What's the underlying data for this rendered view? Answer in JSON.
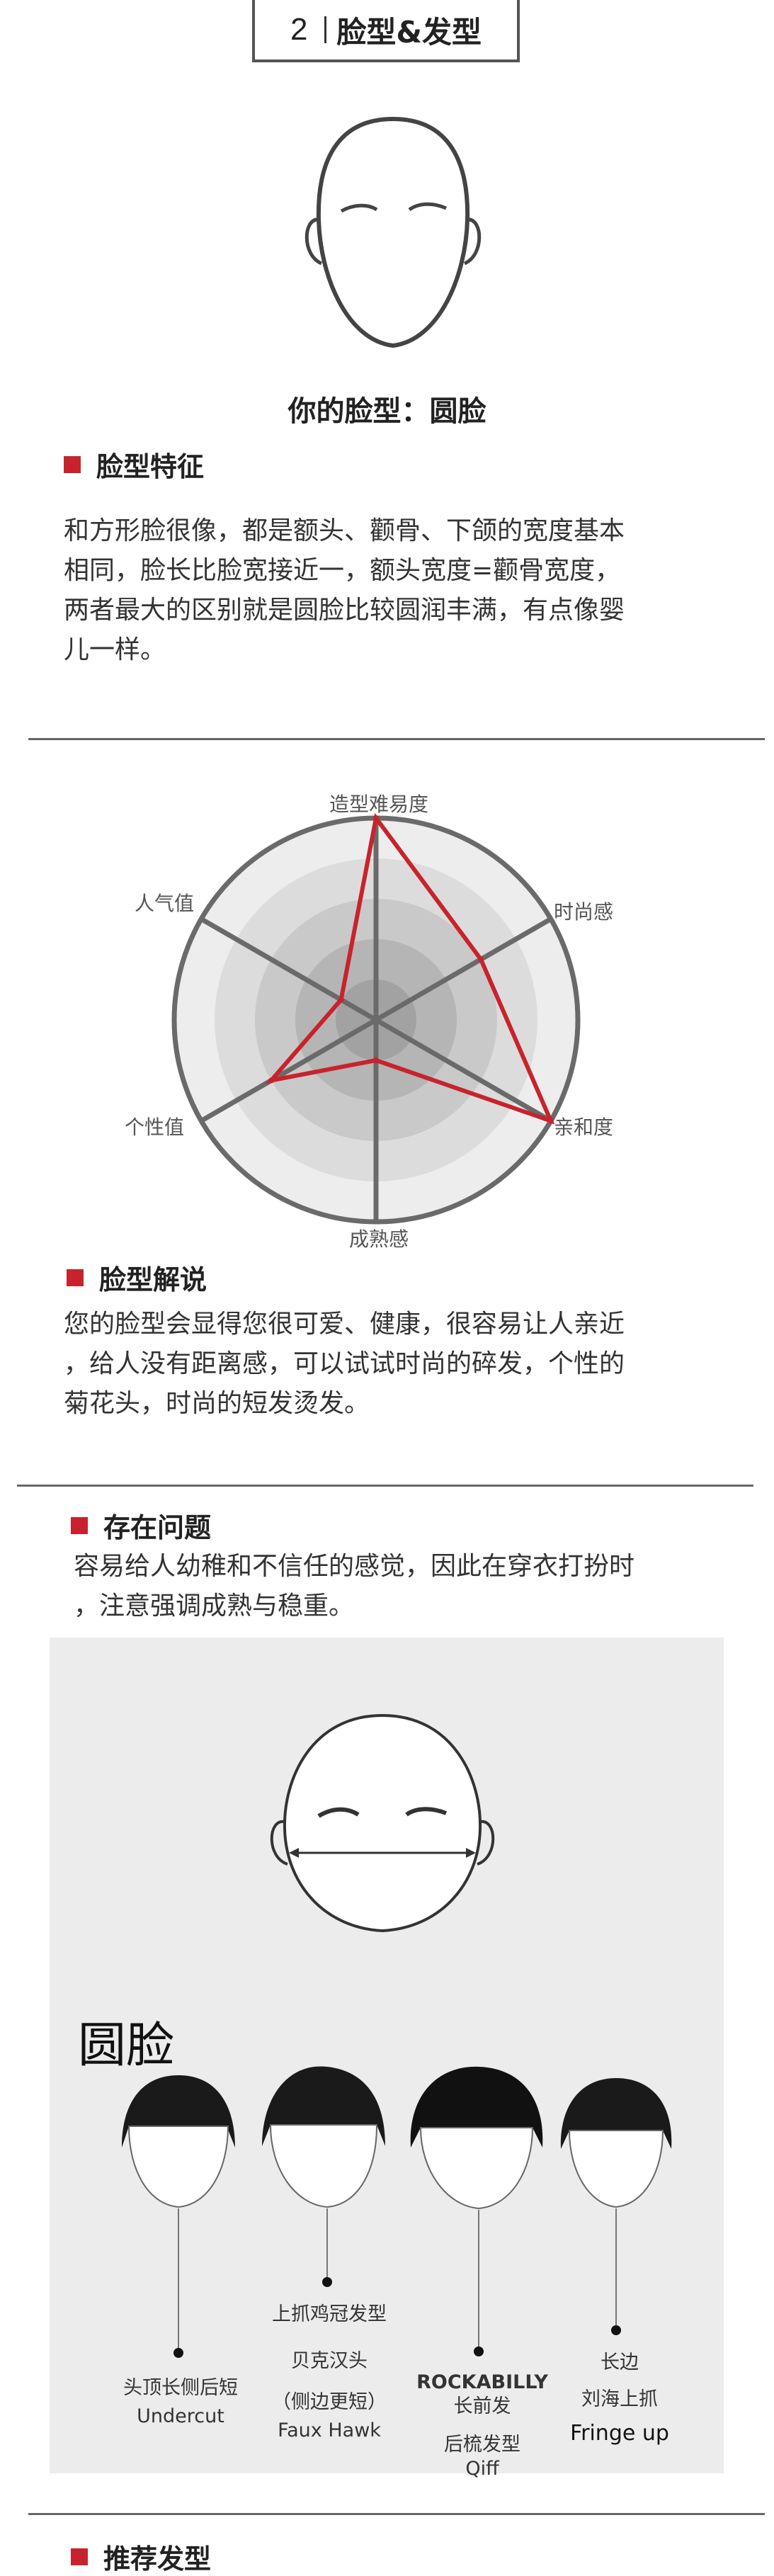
{
  "header": {
    "number": "2",
    "title": "脸型&发型"
  },
  "face_type_line": "你的脸型：圆脸",
  "features": {
    "heading": "脸型特征",
    "lines": [
      "和方形脸很像，都是额头、颧骨、下颌的宽度基本",
      "相同，脸长比脸宽接近一，额头宽度=颧骨宽度，",
      "两者最大的区别就是圆脸比较圆润丰满，有点像婴",
      "儿一样。"
    ]
  },
  "chart_data": {
    "type": "radar",
    "axes": [
      "造型难易度",
      "时尚感",
      "亲和度",
      "成熟感",
      "个性值",
      "人气值"
    ],
    "values": [
      5,
      3,
      5,
      1,
      3,
      1
    ],
    "range": [
      0,
      5
    ],
    "series_color": "#c8232c"
  },
  "analysis": {
    "heading": "脸型解说",
    "lines": [
      "您的脸型会显得您很可爱、健康，很容易让人亲近",
      "，给人没有距离感，可以试试时尚的碎发，个性的",
      "菊花头，时尚的短发烫发。"
    ]
  },
  "problems": {
    "heading": "存在问题",
    "lines": [
      "容易给人幼稚和不信任的感觉，因此在穿衣打扮时",
      "，注意强调成熟与稳重。"
    ]
  },
  "illustration": {
    "label": "圆脸",
    "styles": [
      {
        "lines": [
          "头顶长侧后短",
          "Undercut"
        ]
      },
      {
        "lines": [
          "上抓鸡冠发型",
          "贝克汉头",
          "（侧边更短）",
          "Faux Hawk"
        ]
      },
      {
        "lines": [
          "ROCKABILLY",
          "长前发",
          "后梳发型",
          "Qiff"
        ]
      },
      {
        "lines": [
          "长边",
          "刘海上抓",
          "Fringe up"
        ]
      }
    ]
  },
  "recommend": {
    "heading": "推荐发型"
  }
}
